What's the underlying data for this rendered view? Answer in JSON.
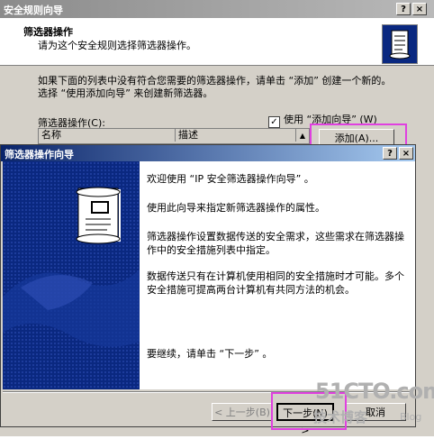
{
  "back_window": {
    "title": "安全规则向导",
    "header_title": "筛选器操作",
    "header_subtitle": "请为这个安全规则选择筛选器操作。",
    "description": "如果下面的列表中没有符合您需要的筛选器操作，请单击 “添加” 创建一个新的。选择 “使用添加向导” 来创建新筛选器。",
    "filter_ops_label": "筛选器操作(C):",
    "use_wizard_label": "使用 “添加向导” (W)",
    "use_wizard_checked": "✓",
    "columns": [
      "名称",
      "描述"
    ],
    "add_button": "添加(A)...",
    "help_btn": "?",
    "close_btn": "×"
  },
  "front_dialog": {
    "title": "筛选器操作向导",
    "welcome": "欢迎使用 “IP 安全筛选器操作向导” 。",
    "intro": "使用此向导来指定新筛选器操作的属性。",
    "para1": "筛选器操作设置数据传送的安全需求，这些需求在筛选器操作中的安全措施列表中指定。",
    "para2": "数据传送只有在计算机使用相同的安全措施时才可能。多个安全措施可提高两台计算机有共同方法的机会。",
    "continue": "要继续，请单击 “下一步” 。",
    "back_button": "< 上一步(B)",
    "next_button": "下一步(N) >",
    "cancel_button": "取消",
    "help_btn": "?",
    "close_btn": "×"
  },
  "watermark": {
    "main": "51CTO.com",
    "sub": "技术博客",
    "blog": "Blog"
  },
  "colors": {
    "active_title_start": "#0a246a",
    "active_title_end": "#a6caf0",
    "highlight": "#e040e0"
  }
}
